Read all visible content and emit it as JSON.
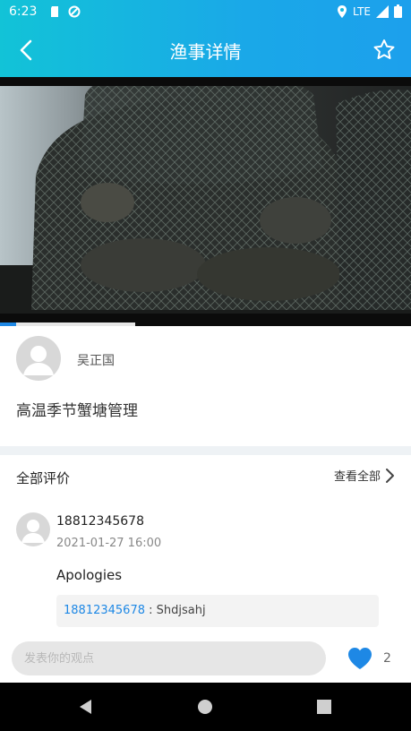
{
  "status_bar": {
    "time": "6:23",
    "network": "LTE"
  },
  "header": {
    "title": "渔事详情"
  },
  "video": {
    "progress_fraction": 0.04,
    "buffer_fraction": 0.33,
    "accent_color": "#1e88e5"
  },
  "author": {
    "name": "吴正国",
    "post_title": "高温季节蟹塘管理"
  },
  "comments": {
    "section_label": "全部评价",
    "view_all_label": "查看全部",
    "items": [
      {
        "user": "18812345678",
        "time": "2021-01-27 16:00",
        "text": "Apologies",
        "reply": {
          "user": "18812345678",
          "separator": " : ",
          "text": "Shdjsahj"
        }
      }
    ]
  },
  "input_bar": {
    "placeholder": "发表你的观点",
    "like_count": "2"
  },
  "icons": {
    "back": "chevron-left-icon",
    "favorite": "star-outline-icon",
    "like": "heart-icon",
    "view_all": "chevron-right-icon"
  },
  "colors": {
    "header_gradient_start": "#12c3d7",
    "header_gradient_end": "#1ca0ec",
    "link_blue": "#1e88e5"
  }
}
